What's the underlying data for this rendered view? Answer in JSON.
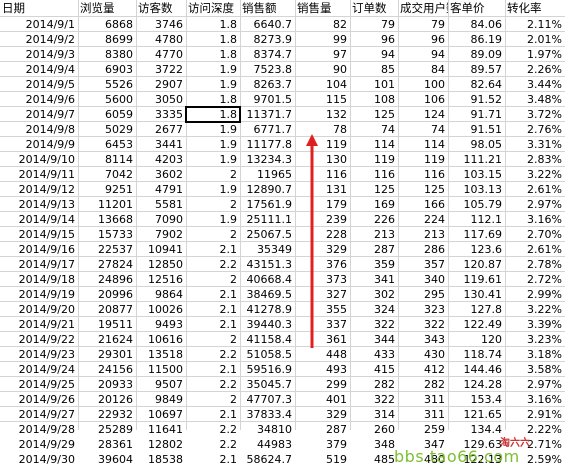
{
  "columns": [
    "日期",
    "浏览量",
    "访客数",
    "访问深度",
    "销售额",
    "销售量",
    "订单数",
    "成交用户数",
    "客单价",
    "转化率"
  ],
  "rows": [
    [
      "2014/9/1",
      "6868",
      "3746",
      "1.8",
      "6640.7",
      "82",
      "79",
      "79",
      "84.06",
      "2.11%"
    ],
    [
      "2014/9/2",
      "8699",
      "4780",
      "1.8",
      "8273.9",
      "99",
      "96",
      "96",
      "86.19",
      "2.01%"
    ],
    [
      "2014/9/3",
      "8380",
      "4770",
      "1.8",
      "8374.7",
      "97",
      "94",
      "94",
      "89.09",
      "1.97%"
    ],
    [
      "2014/9/4",
      "6903",
      "3722",
      "1.9",
      "7523.8",
      "90",
      "85",
      "84",
      "89.57",
      "2.26%"
    ],
    [
      "2014/9/5",
      "5526",
      "2907",
      "1.9",
      "8263.7",
      "104",
      "101",
      "100",
      "82.64",
      "3.44%"
    ],
    [
      "2014/9/6",
      "5600",
      "3050",
      "1.8",
      "9701.5",
      "115",
      "108",
      "106",
      "91.52",
      "3.48%"
    ],
    [
      "2014/9/7",
      "6059",
      "3335",
      "1.8",
      "11371.7",
      "132",
      "125",
      "124",
      "91.71",
      "3.72%"
    ],
    [
      "2014/9/8",
      "5029",
      "2677",
      "1.9",
      "6771.7",
      "78",
      "74",
      "74",
      "91.51",
      "2.76%"
    ],
    [
      "2014/9/9",
      "6453",
      "3441",
      "1.9",
      "11177.8",
      "119",
      "114",
      "114",
      "98.05",
      "3.31%"
    ],
    [
      "2014/9/10",
      "8114",
      "4203",
      "1.9",
      "13234.3",
      "130",
      "119",
      "119",
      "111.21",
      "2.83%"
    ],
    [
      "2014/9/11",
      "7042",
      "3602",
      "2",
      "11965",
      "116",
      "116",
      "116",
      "103.15",
      "3.22%"
    ],
    [
      "2014/9/12",
      "9251",
      "4791",
      "1.9",
      "12890.7",
      "131",
      "125",
      "125",
      "103.13",
      "2.61%"
    ],
    [
      "2014/9/13",
      "11201",
      "5581",
      "2",
      "17561.9",
      "179",
      "169",
      "166",
      "105.79",
      "2.97%"
    ],
    [
      "2014/9/14",
      "13668",
      "7090",
      "1.9",
      "25111.1",
      "239",
      "226",
      "224",
      "112.1",
      "3.16%"
    ],
    [
      "2014/9/15",
      "15733",
      "7902",
      "2",
      "25067.5",
      "228",
      "213",
      "213",
      "117.69",
      "2.70%"
    ],
    [
      "2014/9/16",
      "22537",
      "10941",
      "2.1",
      "35349",
      "329",
      "287",
      "286",
      "123.6",
      "2.61%"
    ],
    [
      "2014/9/17",
      "27824",
      "12850",
      "2.2",
      "43151.3",
      "376",
      "359",
      "357",
      "120.87",
      "2.78%"
    ],
    [
      "2014/9/18",
      "24896",
      "12516",
      "2",
      "40668.4",
      "373",
      "341",
      "340",
      "119.61",
      "2.72%"
    ],
    [
      "2014/9/19",
      "20996",
      "9864",
      "2.1",
      "38469.5",
      "327",
      "302",
      "295",
      "130.41",
      "2.99%"
    ],
    [
      "2014/9/20",
      "20877",
      "10026",
      "2.1",
      "41278.9",
      "355",
      "324",
      "323",
      "127.8",
      "3.22%"
    ],
    [
      "2014/9/21",
      "19511",
      "9493",
      "2.1",
      "39440.3",
      "337",
      "322",
      "322",
      "122.49",
      "3.39%"
    ],
    [
      "2014/9/22",
      "21624",
      "10616",
      "2",
      "41158.4",
      "361",
      "344",
      "343",
      "120",
      "3.23%"
    ],
    [
      "2014/9/23",
      "29301",
      "13518",
      "2.2",
      "51058.5",
      "448",
      "433",
      "430",
      "118.74",
      "3.18%"
    ],
    [
      "2014/9/24",
      "24156",
      "11500",
      "2.1",
      "59516.9",
      "493",
      "415",
      "412",
      "144.46",
      "3.58%"
    ],
    [
      "2014/9/25",
      "20933",
      "9507",
      "2.2",
      "35045.7",
      "299",
      "282",
      "282",
      "124.28",
      "2.97%"
    ],
    [
      "2014/9/26",
      "20126",
      "9849",
      "2",
      "47707.3",
      "401",
      "322",
      "311",
      "153.4",
      "3.16%"
    ],
    [
      "2014/9/27",
      "22932",
      "10697",
      "2.1",
      "37833.4",
      "329",
      "314",
      "311",
      "121.65",
      "2.91%"
    ],
    [
      "2014/9/28",
      "25289",
      "11641",
      "2.2",
      "34810",
      "287",
      "260",
      "259",
      "134.4",
      "2.22%"
    ],
    [
      "2014/9/29",
      "28361",
      "12802",
      "2.2",
      "44983",
      "379",
      "348",
      "347",
      "129.63",
      "2.71%"
    ],
    [
      "2014/9/30",
      "39604",
      "18538",
      "2.1",
      "58624.7",
      "519",
      "485",
      "480",
      "122.13",
      "2.59%"
    ]
  ],
  "selected_cell": {
    "row": 6,
    "col": 3
  },
  "annotation": {
    "arrow_color": "#e02020"
  },
  "watermark": {
    "url": "bbs.tao66.com",
    "logo": "淘六六"
  }
}
